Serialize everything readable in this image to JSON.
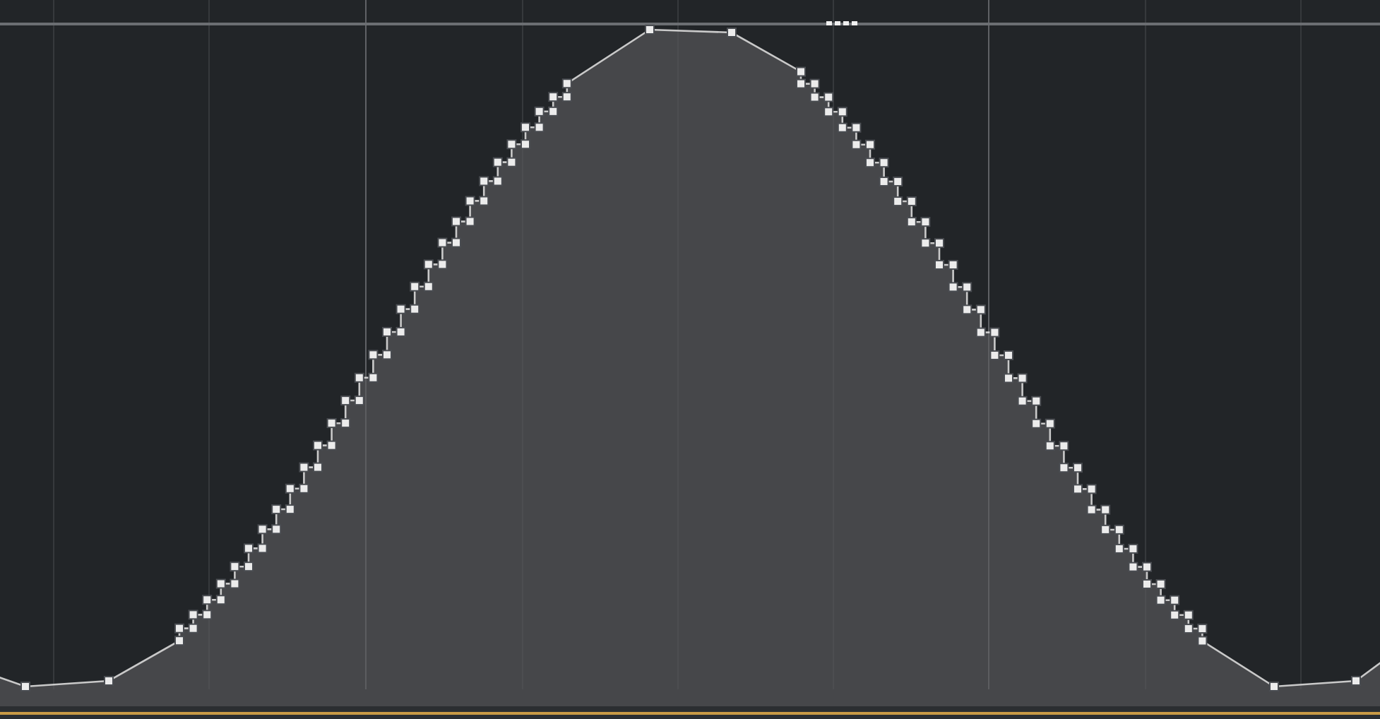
{
  "lane": {
    "kind": "automation"
  }
}
